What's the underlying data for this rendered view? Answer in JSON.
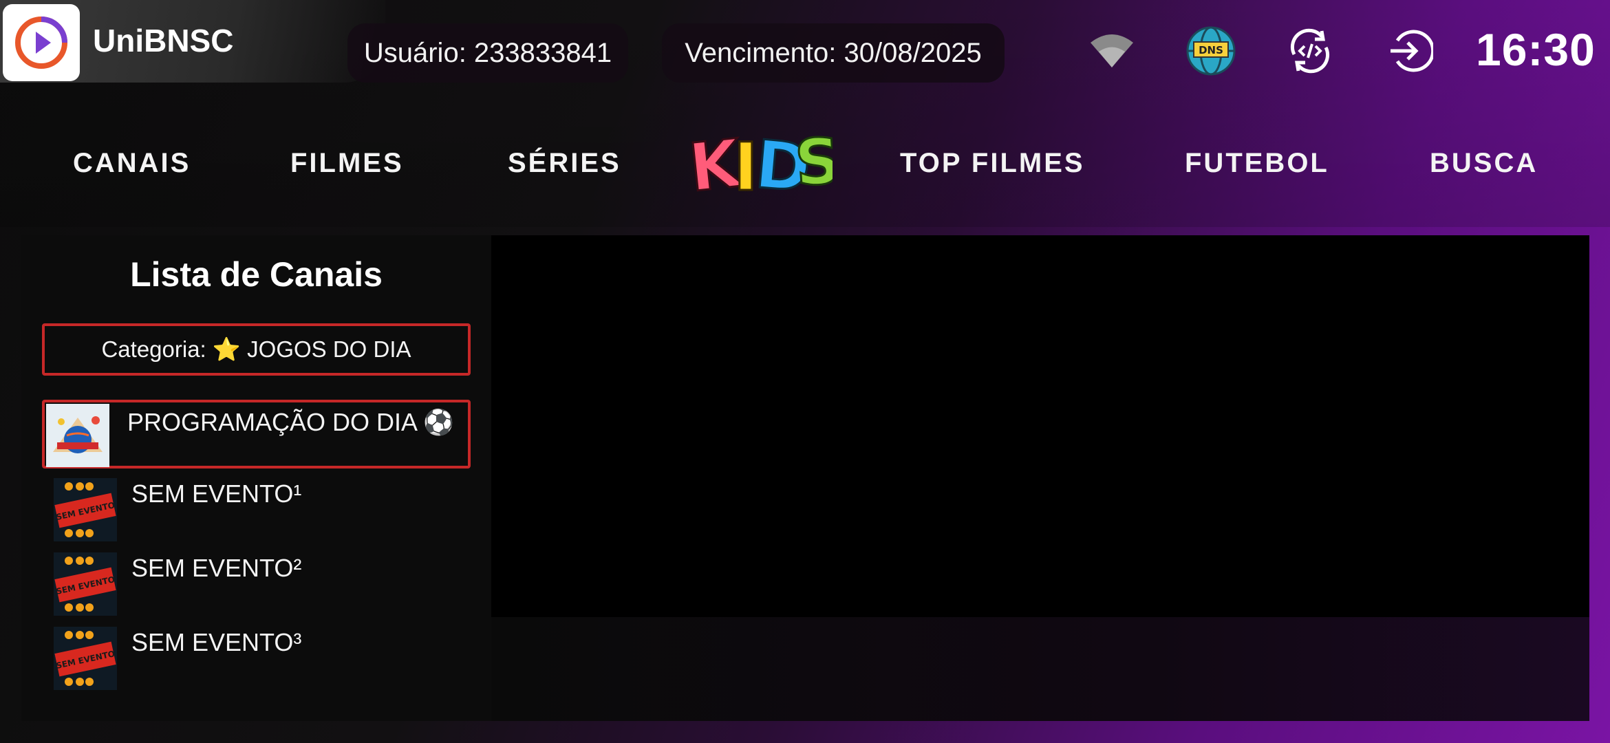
{
  "header": {
    "app_name": "UniBNSC",
    "user_label": "Usuário: 233833841",
    "expiry_label": "Vencimento: 30/08/2025",
    "clock": "16:30",
    "icons": [
      "wifi-icon",
      "dns-icon",
      "sync-icon",
      "logout-icon"
    ]
  },
  "nav": {
    "items": [
      "CANAIS",
      "FILMES",
      "SÉRIES",
      "KIDS",
      "TOP FILMES",
      "FUTEBOL",
      "BUSCA"
    ]
  },
  "channels_panel": {
    "title": "Lista de Canais",
    "category": "Categoria: ⭐ JOGOS DO DIA",
    "items": [
      {
        "name": "PROGRAMAÇÃO DO DIA ⚽",
        "selected": true,
        "thumb_text": ""
      },
      {
        "name": "SEM EVENTO¹",
        "selected": false,
        "thumb_text": "SEM EVENTO"
      },
      {
        "name": "SEM EVENTO²",
        "selected": false,
        "thumb_text": "SEM EVENTO"
      },
      {
        "name": "SEM EVENTO³",
        "selected": false,
        "thumb_text": "SEM EVENTO"
      }
    ]
  },
  "colors": {
    "accent_red": "#c62828",
    "purple": "#7a14a4",
    "kids_letters": [
      "#ff5c7a",
      "#ffd21f",
      "#2aa9f5",
      "#8ad43a"
    ]
  }
}
